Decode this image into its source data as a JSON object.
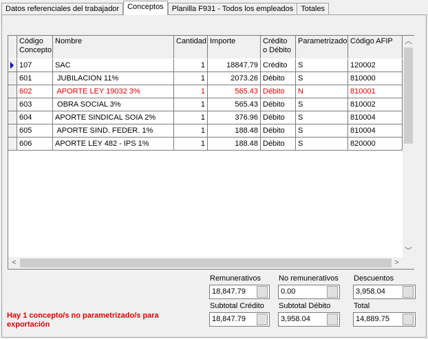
{
  "tabs": [
    {
      "label": "Datos referenciales del trabajador"
    },
    {
      "label": "Conceptos"
    },
    {
      "label": "Planilla F931 - Todos los empleados"
    },
    {
      "label": "Totales"
    }
  ],
  "grid": {
    "headers": [
      "Código Concepto",
      "Nombre",
      "Cantidad",
      "Importe",
      "Crédito o Débito",
      "Parametrizado",
      "Código AFIP"
    ],
    "rows": [
      {
        "codigo": "107",
        "nombre": "SAC",
        "cantidad": "1",
        "importe": "18847.79",
        "cd": "Crédito",
        "param": "S",
        "afip": "120002"
      },
      {
        "codigo": "601",
        "nombre": " JUBILACION 11%",
        "cantidad": "1",
        "importe": "2073.26",
        "cd": "Débito",
        "param": "S",
        "afip": "810000"
      },
      {
        "codigo": "602",
        "nombre": " APORTE LEY 19032 3%",
        "cantidad": "1",
        "importe": "565.43",
        "cd": "Débito",
        "param": "N",
        "afip": "810001"
      },
      {
        "codigo": "603",
        "nombre": " OBRA SOCIAL 3%",
        "cantidad": "1",
        "importe": "565.43",
        "cd": "Débito",
        "param": "S",
        "afip": "810002"
      },
      {
        "codigo": "604",
        "nombre": "APORTE SINDICAL SOIA 2%",
        "cantidad": "1",
        "importe": "376.96",
        "cd": "Débito",
        "param": "S",
        "afip": "810004"
      },
      {
        "codigo": "605",
        "nombre": " APORTE SIND. FEDER. 1%",
        "cantidad": "1",
        "importe": "188.48",
        "cd": "Débito",
        "param": "S",
        "afip": "810004"
      },
      {
        "codigo": "606",
        "nombre": "APORTE LEY 482 - IPS 1%",
        "cantidad": "1",
        "importe": "188.48",
        "cd": "Débito",
        "param": "S",
        "afip": "820000"
      }
    ]
  },
  "totals": {
    "remunerativos": {
      "label": "Remunerativos",
      "value": "18,847.79"
    },
    "no_remunerativos": {
      "label": "No remunerativos",
      "value": "0.00"
    },
    "descuentos": {
      "label": "Descuentos",
      "value": "3,958.04"
    },
    "subtotal_credito": {
      "label": "Subtotal Crédito",
      "value": "18,847.79"
    },
    "subtotal_debito": {
      "label": "Subtotal Débito",
      "value": "3,958.04"
    },
    "total": {
      "label": "Total",
      "value": "14,889.75"
    }
  },
  "warning": "Hay 1 concepto/s no parametrizado/s para exportación",
  "icons": {
    "row_indicator": "triangle-right-icon",
    "scroll_up": "chevron-up-icon",
    "scroll_down": "chevron-down-icon",
    "scroll_left": "chevron-left-icon",
    "scroll_right": "chevron-right-icon"
  },
  "colors": {
    "warning": "#e00000",
    "indicator": "#0000c0"
  }
}
